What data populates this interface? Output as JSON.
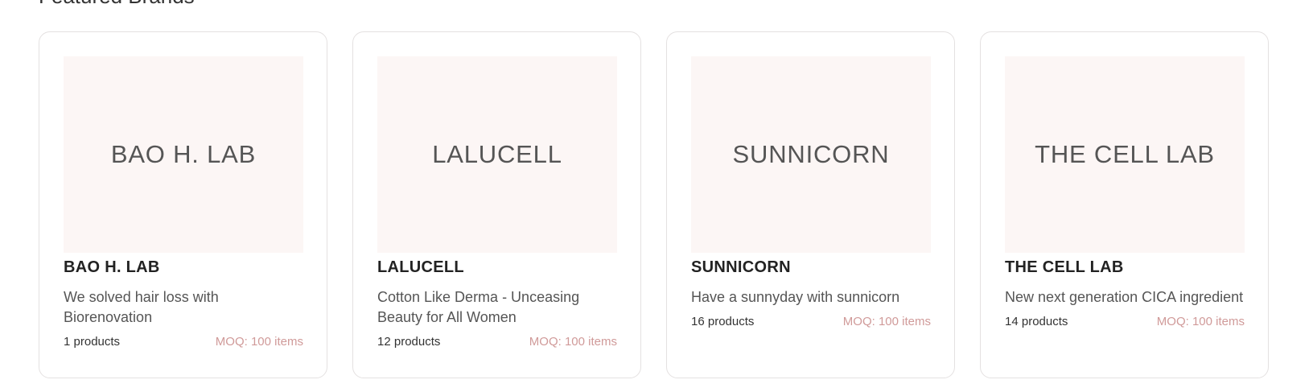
{
  "section": {
    "title": "Featured Brands"
  },
  "brands": [
    {
      "logo_text": "BAO H. LAB",
      "name": "BAO H. LAB",
      "description": "We solved hair loss with Biorenovation",
      "products": "1 products",
      "moq": "MOQ: 100 items"
    },
    {
      "logo_text": "LALUCELL",
      "name": "LALUCELL",
      "description": "Cotton Like Derma - Unceasing Beauty for All Women",
      "products": "12 products",
      "moq": "MOQ: 100 items"
    },
    {
      "logo_text": "SUNNICORN",
      "name": "SUNNICORN",
      "description": "Have a sunnyday with sunnicorn",
      "products": "16 products",
      "moq": "MOQ: 100 items"
    },
    {
      "logo_text": "THE CELL LAB",
      "name": "THE CELL LAB",
      "description": "New next generation CICA ingredient",
      "products": "14 products",
      "moq": "MOQ: 100 items"
    }
  ],
  "colors": {
    "logo_background": "#fcf6f5",
    "moq_text": "#d09a99",
    "card_border": "#e4e1e1"
  }
}
